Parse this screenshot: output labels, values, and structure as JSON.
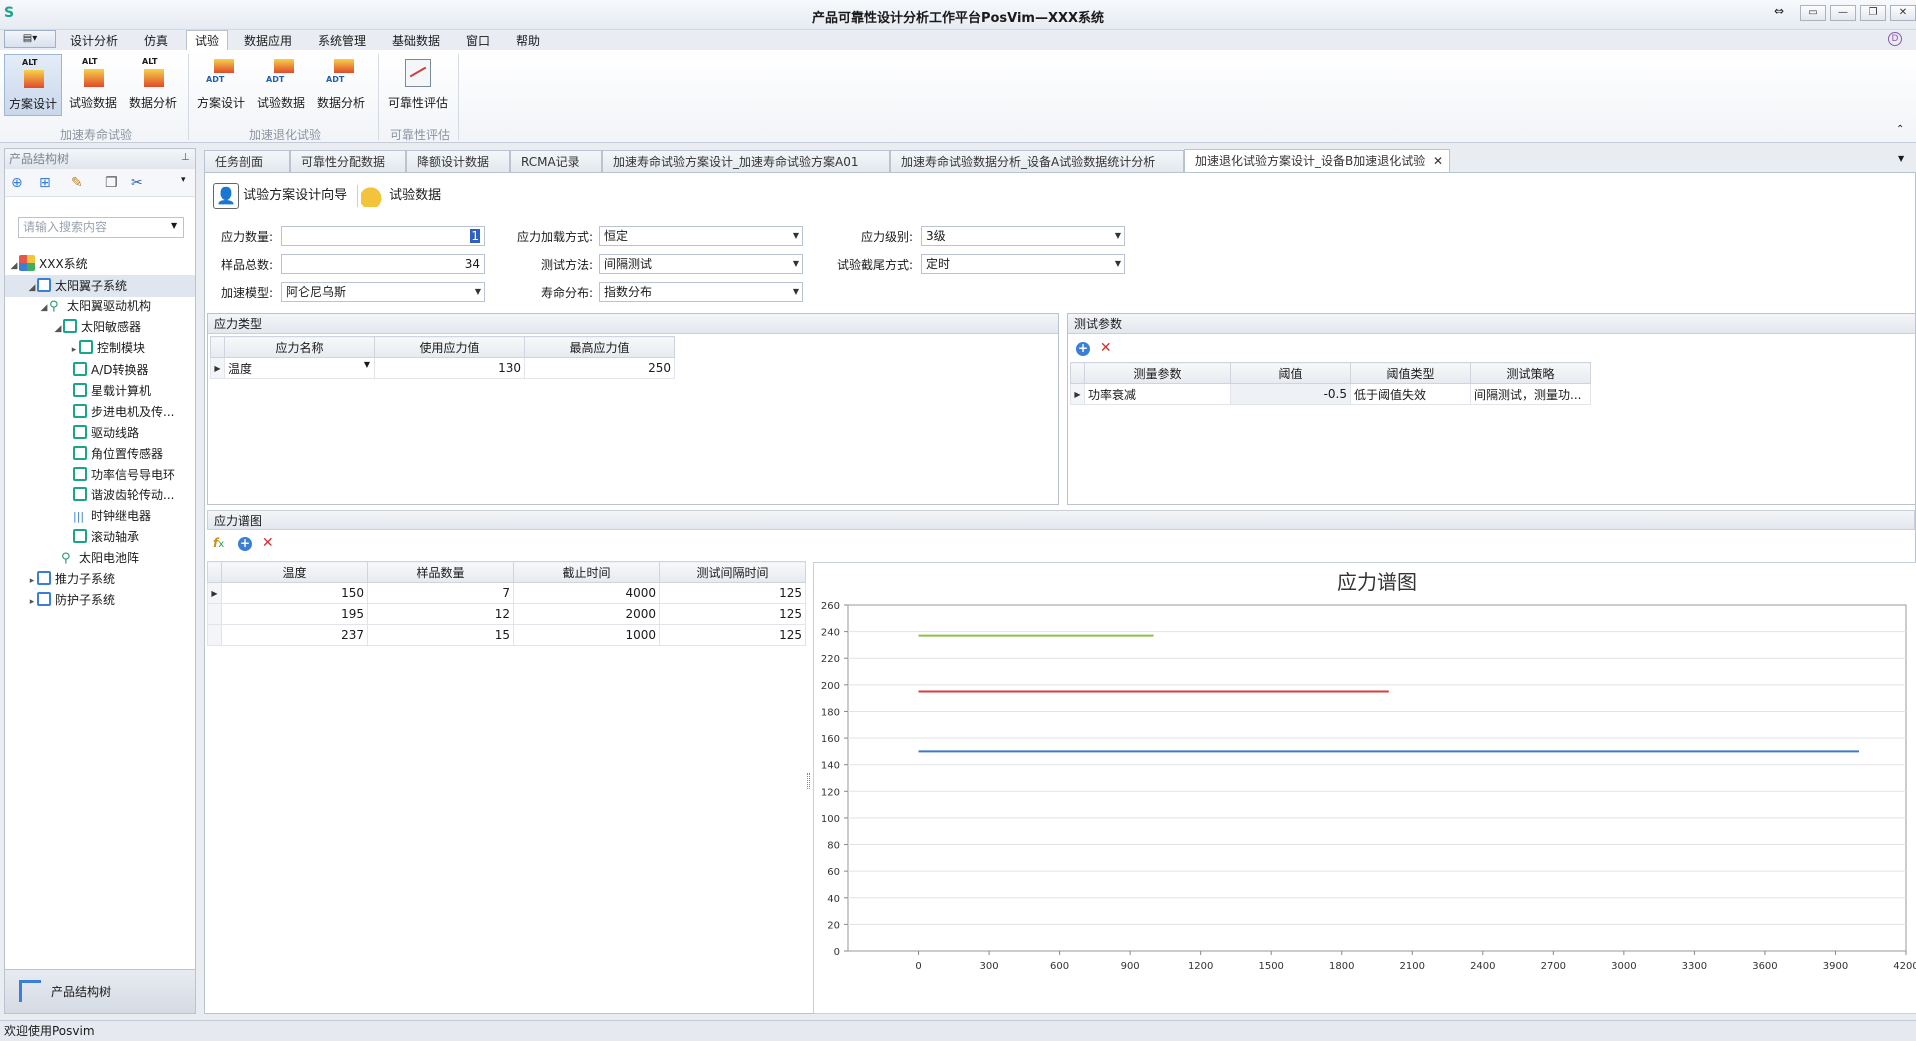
{
  "window": {
    "title": "产品可靠性设计分析工作平台PosVim—XXX系统"
  },
  "menu": [
    "设计分析",
    "仿真",
    "试验",
    "数据应用",
    "系统管理",
    "基础数据",
    "窗口",
    "帮助"
  ],
  "ribbon": {
    "buttons": [
      {
        "label": "方案设计",
        "badge": "ALT"
      },
      {
        "label": "试验数据",
        "badge": "ALT"
      },
      {
        "label": "数据分析",
        "badge": "ALT"
      },
      {
        "label": "方案设计",
        "badge": "ADT"
      },
      {
        "label": "试验数据",
        "badge": "ADT"
      },
      {
        "label": "数据分析",
        "badge": "ADT"
      },
      {
        "label": "可靠性评估",
        "badge": ""
      }
    ],
    "groups": [
      "加速寿命试验",
      "加速退化试验",
      "可靠性评估"
    ]
  },
  "left_panel": {
    "title": "产品结构树",
    "search_placeholder": "请输入搜索内容",
    "tree": [
      "XXX系统",
      "太阳翼子系统",
      "太阳翼驱动机构",
      "太阳敏感器",
      "控制模块",
      "A/D转换器",
      "星载计算机",
      "步进电机及传...",
      "驱动线路",
      "角位置传感器",
      "功率信号导电环",
      "谐波齿轮传动...",
      "时钟继电器",
      "滚动轴承",
      "太阳电池阵",
      "推力子系统",
      "防护子系统"
    ],
    "bottom_button": "产品结构树"
  },
  "tabs": [
    "任务剖面",
    "可靠性分配数据",
    "降额设计数据",
    "RCMA记录",
    "加速寿命试验方案设计_加速寿命试验方案A01",
    "加速寿命试验数据分析_设备A试验数据统计分析",
    "加速退化试验方案设计_设备B加速退化试验"
  ],
  "subtoolbar": {
    "wizard": "试验方案设计向导",
    "data": "试验数据"
  },
  "form": {
    "stress_count": {
      "label": "应力数量:",
      "value": "1"
    },
    "sample_total": {
      "label": "样品总数:",
      "value": "34"
    },
    "accel_model": {
      "label": "加速模型:",
      "value": "阿仑尼乌斯"
    },
    "load_method": {
      "label": "应力加载方式:",
      "value": "恒定"
    },
    "test_method": {
      "label": "测试方法:",
      "value": "间隔测试"
    },
    "life_dist": {
      "label": "寿命分布:",
      "value": "指数分布"
    },
    "stress_level": {
      "label": "应力级别:",
      "value": "3级"
    },
    "censor": {
      "label": "试验截尾方式:",
      "value": "定时"
    }
  },
  "stress_type": {
    "title": "应力类型",
    "columns": [
      "应力名称",
      "使用应力值",
      "最高应力值"
    ],
    "rows": [
      [
        "温度",
        "130",
        "250"
      ]
    ]
  },
  "test_params": {
    "title": "测试参数",
    "columns": [
      "测量参数",
      "阈值",
      "阈值类型",
      "测试策略"
    ],
    "rows": [
      [
        "功率衰减",
        "-0.5",
        "低于阈值失效",
        "间隔测试，测量功..."
      ]
    ]
  },
  "stress_spectrum": {
    "title": "应力谱图",
    "columns": [
      "温度",
      "样品数量",
      "截止时间",
      "测试间隔时间"
    ],
    "rows": [
      [
        "150",
        "7",
        "4000",
        "125"
      ],
      [
        "195",
        "12",
        "2000",
        "125"
      ],
      [
        "237",
        "15",
        "1000",
        "125"
      ]
    ]
  },
  "chart_data": {
    "type": "line",
    "title": "应力谱图",
    "xlabel": "",
    "ylabel": "",
    "xlim": [
      -300,
      4200
    ],
    "ylim": [
      0,
      260
    ],
    "xticks": [
      0,
      300,
      600,
      900,
      1200,
      1500,
      1800,
      2100,
      2400,
      2700,
      3000,
      3300,
      3600,
      3900,
      4200
    ],
    "yticks": [
      0,
      20,
      40,
      60,
      80,
      100,
      120,
      140,
      160,
      180,
      200,
      220,
      240,
      260
    ],
    "grid": true,
    "series": [
      {
        "color": "#3c78c8",
        "x": [
          0,
          4000
        ],
        "y": [
          150,
          150
        ]
      },
      {
        "color": "#d83c3c",
        "x": [
          0,
          2000
        ],
        "y": [
          195,
          195
        ]
      },
      {
        "color": "#8cc24a",
        "x": [
          0,
          1000
        ],
        "y": [
          237,
          237
        ]
      }
    ]
  },
  "status": "欢迎使用Posvim"
}
